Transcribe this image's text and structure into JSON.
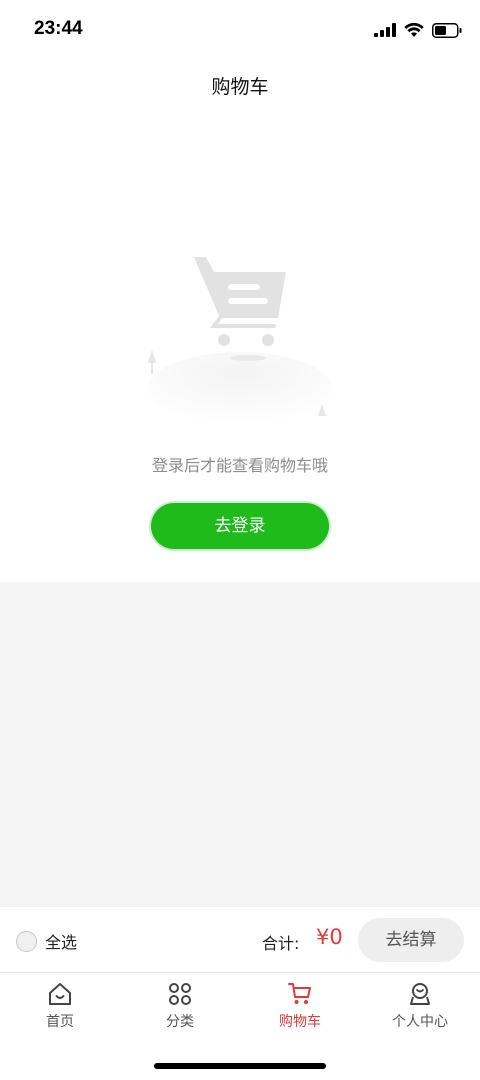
{
  "status_bar": {
    "time": "23:44",
    "icons": [
      "signal-icon",
      "wifi-icon",
      "battery-icon"
    ]
  },
  "header": {
    "title": "购物车"
  },
  "empty_state": {
    "illustration": "empty-cart-illustration",
    "message": "登录后才能查看购物车哦",
    "login_button": "去登录"
  },
  "checkout_bar": {
    "select_all_label": "全选",
    "total_label": "合计:",
    "total_value": "¥0",
    "checkout_button": "去结算"
  },
  "tab_bar": {
    "items": [
      {
        "label": "首页",
        "icon": "home-icon",
        "active": false
      },
      {
        "label": "分类",
        "icon": "category-icon",
        "active": false
      },
      {
        "label": "购物车",
        "icon": "cart-icon",
        "active": true
      },
      {
        "label": "个人中心",
        "icon": "profile-icon",
        "active": false
      }
    ]
  },
  "colors": {
    "accent_green": "#1fba1c",
    "active_red": "#e23a3a",
    "background": "#f5f5f5"
  }
}
